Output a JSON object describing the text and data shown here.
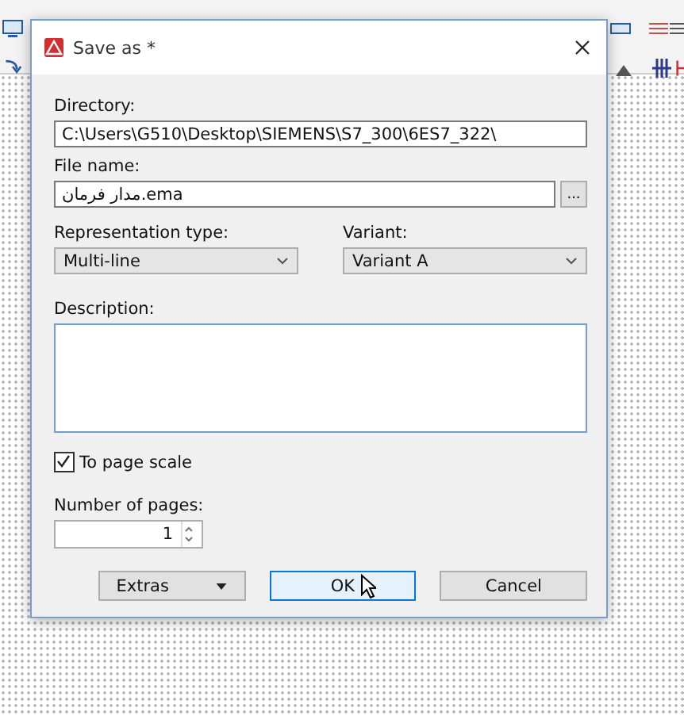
{
  "dialog": {
    "title": "Save as *",
    "directory": {
      "label": "Directory:",
      "value": "C:\\Users\\G510\\Desktop\\SIEMENS\\S7_300\\6ES7_322\\"
    },
    "file_name": {
      "label": "File name:",
      "value": "مدار فرمان.ema",
      "browse": "..."
    },
    "representation_type": {
      "label": "Representation type:",
      "value": "Multi-line"
    },
    "variant": {
      "label": "Variant:",
      "value": "Variant A"
    },
    "description": {
      "label": "Description:"
    },
    "to_page_scale": {
      "label": "To page scale",
      "checked": true
    },
    "number_of_pages": {
      "label": "Number of pages:",
      "value": "1"
    },
    "buttons": [
      {
        "label": "Extras",
        "kind": "menu",
        "focused": false
      },
      {
        "label": "OK",
        "kind": "plain",
        "focused": true
      },
      {
        "label": "Cancel",
        "kind": "plain",
        "focused": false
      }
    ]
  }
}
